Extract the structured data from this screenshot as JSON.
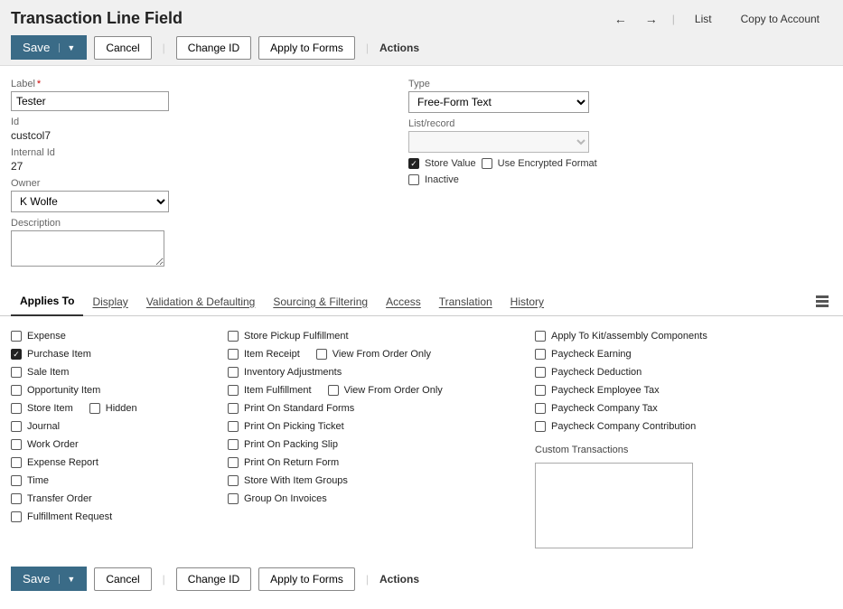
{
  "header": {
    "title": "Transaction Line Field",
    "nav": {
      "prev": "←",
      "next": "→",
      "list": "List",
      "copy": "Copy to Account"
    }
  },
  "toolbar": {
    "save": "Save",
    "cancel": "Cancel",
    "changeId": "Change ID",
    "applyForms": "Apply to Forms",
    "actions": "Actions"
  },
  "form": {
    "label_lbl": "Label",
    "label_val": "Tester",
    "id_lbl": "Id",
    "id_val": "custcol7",
    "internalId_lbl": "Internal Id",
    "internalId_val": "27",
    "owner_lbl": "Owner",
    "owner_val": "K Wolfe",
    "desc_lbl": "Description",
    "type_lbl": "Type",
    "type_val": "Free-Form Text",
    "listrec_lbl": "List/record",
    "listrec_val": "",
    "storeValue": "Store Value",
    "useEncrypted": "Use Encrypted Format",
    "inactive": "Inactive"
  },
  "tabs": {
    "appliesTo": "Applies To",
    "display": "Display",
    "validation": "Validation & Defaulting",
    "sourcing": "Sourcing & Filtering",
    "access": "Access",
    "translation": "Translation",
    "history": "History"
  },
  "applies": {
    "c1": {
      "expense": "Expense",
      "purchaseItem": "Purchase Item",
      "saleItem": "Sale Item",
      "opportunityItem": "Opportunity Item",
      "storeItem": "Store Item",
      "hidden": "Hidden",
      "journal": "Journal",
      "workOrder": "Work Order",
      "expenseReport": "Expense Report",
      "time": "Time",
      "transferOrder": "Transfer Order",
      "fulfillmentRequest": "Fulfillment Request"
    },
    "c2": {
      "storePickup": "Store Pickup Fulfillment",
      "itemReceipt": "Item Receipt",
      "viewFromOrder1": "View From Order Only",
      "inventoryAdj": "Inventory Adjustments",
      "itemFulfillment": "Item Fulfillment",
      "viewFromOrder2": "View From Order Only",
      "printStandard": "Print On Standard Forms",
      "printPicking": "Print On Picking Ticket",
      "printPacking": "Print On Packing Slip",
      "printReturn": "Print On Return Form",
      "storeItemGroups": "Store With Item Groups",
      "groupInvoices": "Group On Invoices"
    },
    "c3": {
      "applyKit": "Apply To Kit/assembly Components",
      "paycheckEarning": "Paycheck Earning",
      "paycheckDeduction": "Paycheck Deduction",
      "paycheckEmpTax": "Paycheck Employee Tax",
      "paycheckCompTax": "Paycheck Company Tax",
      "paycheckCompContrib": "Paycheck Company Contribution",
      "customTrans": "Custom Transactions"
    }
  }
}
